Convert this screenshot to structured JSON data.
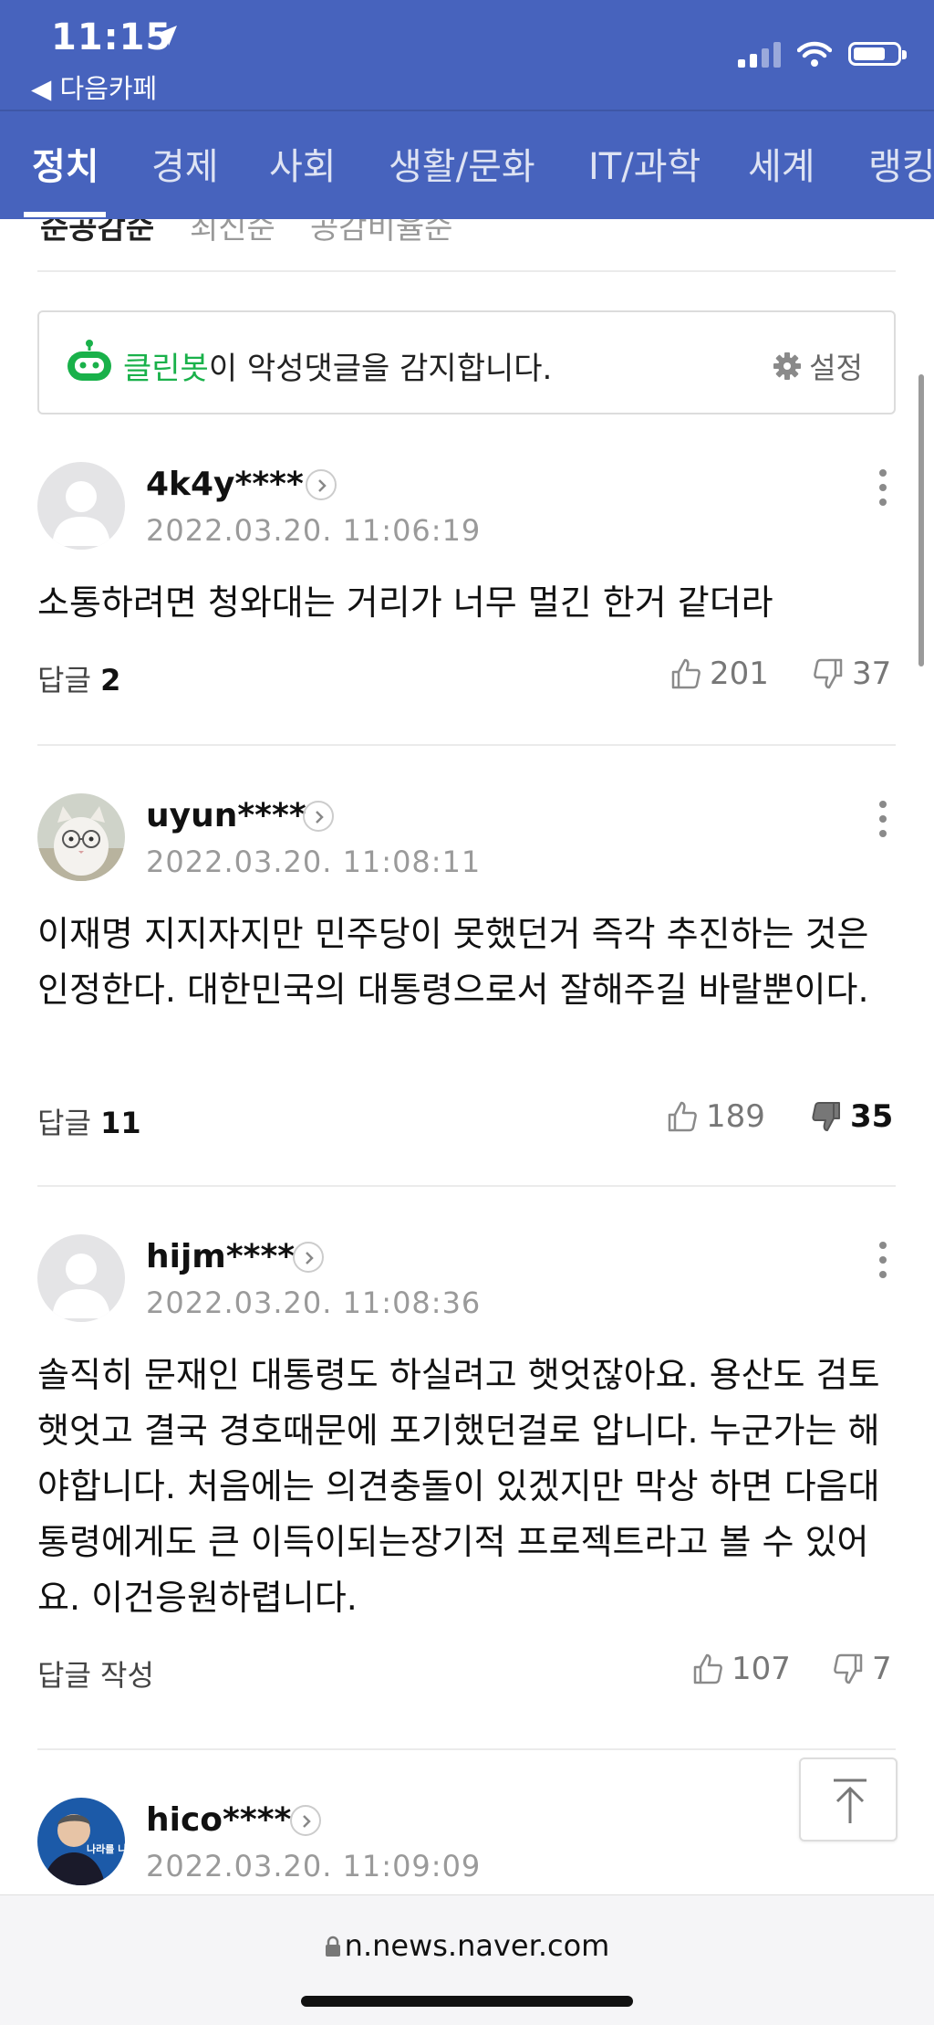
{
  "status_bar": {
    "time": "11:15",
    "back_app": "◀ 다음카페"
  },
  "tabs": [
    {
      "label": "정치",
      "active": true
    },
    {
      "label": "경제",
      "active": false
    },
    {
      "label": "사회",
      "active": false
    },
    {
      "label": "생활/문화",
      "active": false
    },
    {
      "label": "IT/과학",
      "active": false
    },
    {
      "label": "세계",
      "active": false
    },
    {
      "label": "랭킹",
      "active": false
    }
  ],
  "sort_options": [
    "순공감순",
    "최신순",
    "공감비율순"
  ],
  "cleanbot": {
    "brand": "클린봇",
    "message": "이 악성댓글을 감지합니다.",
    "settings_label": "설정",
    "brand_color": "#19b14a"
  },
  "comments": [
    {
      "username": "4k4y****",
      "date": "2022.03.20. 11:06:19",
      "text": "소통하려면 청와대는 거리가 너무 멀긴 한거 같더라",
      "reply_label": "답글",
      "reply_count": "2",
      "likes": "201",
      "dislikes": "37",
      "avatar": "default"
    },
    {
      "username": "uyun****",
      "date": "2022.03.20. 11:08:11",
      "text": "이재명 지지자지만 민주당이 못했던거 즉각 추진하는 것은 인정한다. 대한민국의 대통령으로서 잘해주길 바랄뿐이다.",
      "reply_label": "답글",
      "reply_count": "11",
      "likes": "189",
      "dislikes": "35",
      "avatar": "cat-with-glasses"
    },
    {
      "username": "hijm****",
      "date": "2022.03.20. 11:08:36",
      "text": "솔직히 문재인 대통령도 하실려고 햇엇잖아요. 용산도 검토 햇엇고 결국 경호때문에 포기했던걸로 압니다. 누군가는 해야합니다. 처음에는 의견충돌이 있겠지만 막상 하면 다음대통령에게도 큰 이득이되는장기적 프로젝트라고 볼 수 있어요. 이건응원하렵니다.",
      "reply_label": "답글 작성",
      "reply_count": "",
      "likes": "107",
      "dislikes": "7",
      "avatar": "default"
    },
    {
      "username": "hico****",
      "date": "2022.03.20. 11:09:09",
      "avatar": "photo",
      "avatar_text": "나라를 나라답게"
    }
  ],
  "url_bar": {
    "url": "n.news.naver.com"
  },
  "colors": {
    "header_blue": "#4763bd",
    "divider": "#ebebeb"
  }
}
